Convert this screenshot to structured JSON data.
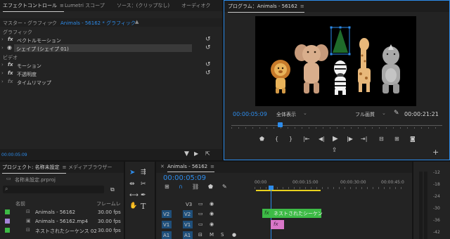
{
  "effect_controls": {
    "tabs": [
      "エフェクトコントロール",
      "Lumetri スコープ",
      "ソース：(クリップなし)",
      "オーディオク"
    ],
    "master_label": "マスター・グラフィック",
    "clip_label": "Animals - 56162 * グラフィック",
    "section_graphic": "グラフィック",
    "vector_motion": "ベクトルモーション",
    "shape_layer": "シェイプ (シェイプ 01)",
    "section_video": "ビデオ",
    "motion": "モーション",
    "opacity": "不透明度",
    "time_remap": "タイムリマップ",
    "fx_badge": "fx",
    "timecode": "00:00:05:09"
  },
  "program_monitor": {
    "tab": "プログラム：Animals - 56162",
    "timecode_current": "00:00:05:09",
    "timecode_duration": "00:00:21:21",
    "zoom_select": "全体表示",
    "quality_select": "フル画質"
  },
  "project": {
    "tabs": [
      "プロジェクト: 名称未設定",
      "メディアブラウザー"
    ],
    "file_name": "名称未設定.prproj",
    "col_name": "名前",
    "col_fps": "フレームレ",
    "items": [
      {
        "name": "Animals - 56162",
        "fps": "30.00 fps",
        "color": "#3dbb46"
      },
      {
        "name": "Animals - 56162.mp4",
        "fps": "30.00 fps",
        "color": "#a585d8"
      },
      {
        "name": "ネストされたシーケンス 02",
        "fps": "30.00 fps",
        "color": "#3dbb46"
      }
    ]
  },
  "timeline": {
    "tab": "Animals - 56162",
    "timecode": "00:00:05:09",
    "ruler_labels": [
      "00:00",
      "00:00:15:00",
      "00:00:30:00",
      "00:00:45:0"
    ],
    "tracks": [
      {
        "source": "",
        "label": "V3"
      },
      {
        "source": "V2",
        "label": "V2"
      },
      {
        "source": "V1",
        "label": "V1"
      },
      {
        "source": "A1",
        "label": "A1"
      }
    ],
    "clip_nested": "ネストされたシーケン",
    "clip_fx": "fx",
    "clip_v1": "fx"
  },
  "audio_meter": {
    "labels": [
      "-12",
      "-18",
      "-24",
      "-30",
      "-36",
      "-42"
    ]
  }
}
